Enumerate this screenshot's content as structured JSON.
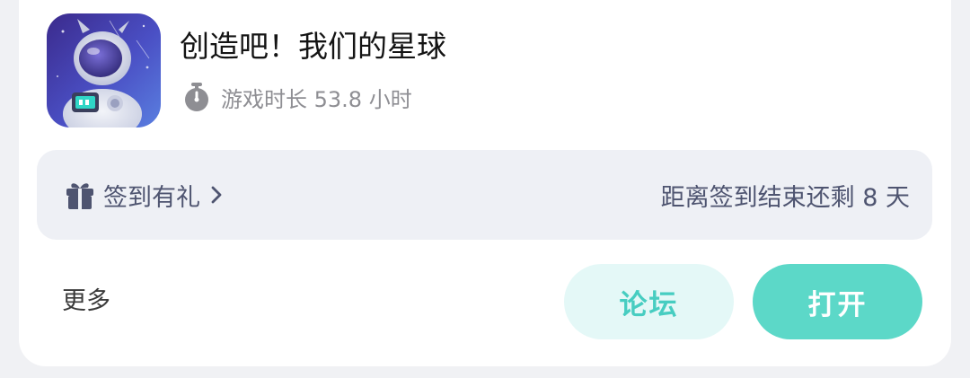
{
  "app": {
    "title": "创造吧！我们的星球",
    "icon": "astronaut-game-icon",
    "playtime_label": "游戏时长 53.8 小时"
  },
  "signin": {
    "label": "签到有礼",
    "remaining_text": "距离签到结束还剩 8 天"
  },
  "footer": {
    "more_label": "更多",
    "forum_button": "论坛",
    "open_button": "打开"
  },
  "colors": {
    "accent": "#5cd8c8",
    "accent_light": "#e4f8f7",
    "accent_text": "#47cdc1",
    "panel_bg": "#eef0f5",
    "muted_text": "#8e8e93"
  }
}
